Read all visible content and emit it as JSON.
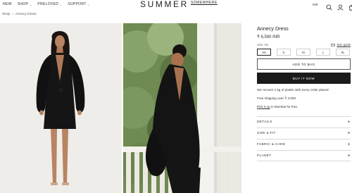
{
  "header": {
    "nav": [
      {
        "label": "NEW",
        "has_menu": false
      },
      {
        "label": "SHOP",
        "has_menu": true
      },
      {
        "label": "PRELOVED",
        "has_menu": true
      },
      {
        "label": "SUPPORT",
        "has_menu": true
      }
    ],
    "brand_main": "SUMMER",
    "brand_sub": "SOMEWHERE",
    "locale": "INR",
    "cart_count": "0",
    "icons": [
      "search-icon",
      "user-icon",
      "cart-icon"
    ]
  },
  "breadcrumb": {
    "home": "Shop",
    "separator": "›",
    "current": "Annecy Dress"
  },
  "product": {
    "title": "Annecy Dress",
    "price": "₹ 6,590 INR",
    "size_label": "Size: XS",
    "size_guide": "Size guide",
    "sizes": [
      "XS",
      "S",
      "M",
      "L",
      "XL"
    ],
    "selected_size": "XS",
    "add_to_bag": "ADD TO BAG",
    "buy_now": "BUY IT NOW",
    "note_plastic": "We recover 1 kg of plastic with every order placed",
    "note_shipping": "Free shipping over ₹ 4,000.",
    "pickup_link": "Pick it up",
    "pickup_rest": " in Mumbai for free.",
    "accordion": [
      "DETAILS",
      "SIZE & FIT",
      "FABRIC & CARE",
      "PLANET"
    ]
  },
  "colors": {
    "accent": "#1b1b1b",
    "border": "#cfcfcf",
    "background": "#ffffff"
  }
}
